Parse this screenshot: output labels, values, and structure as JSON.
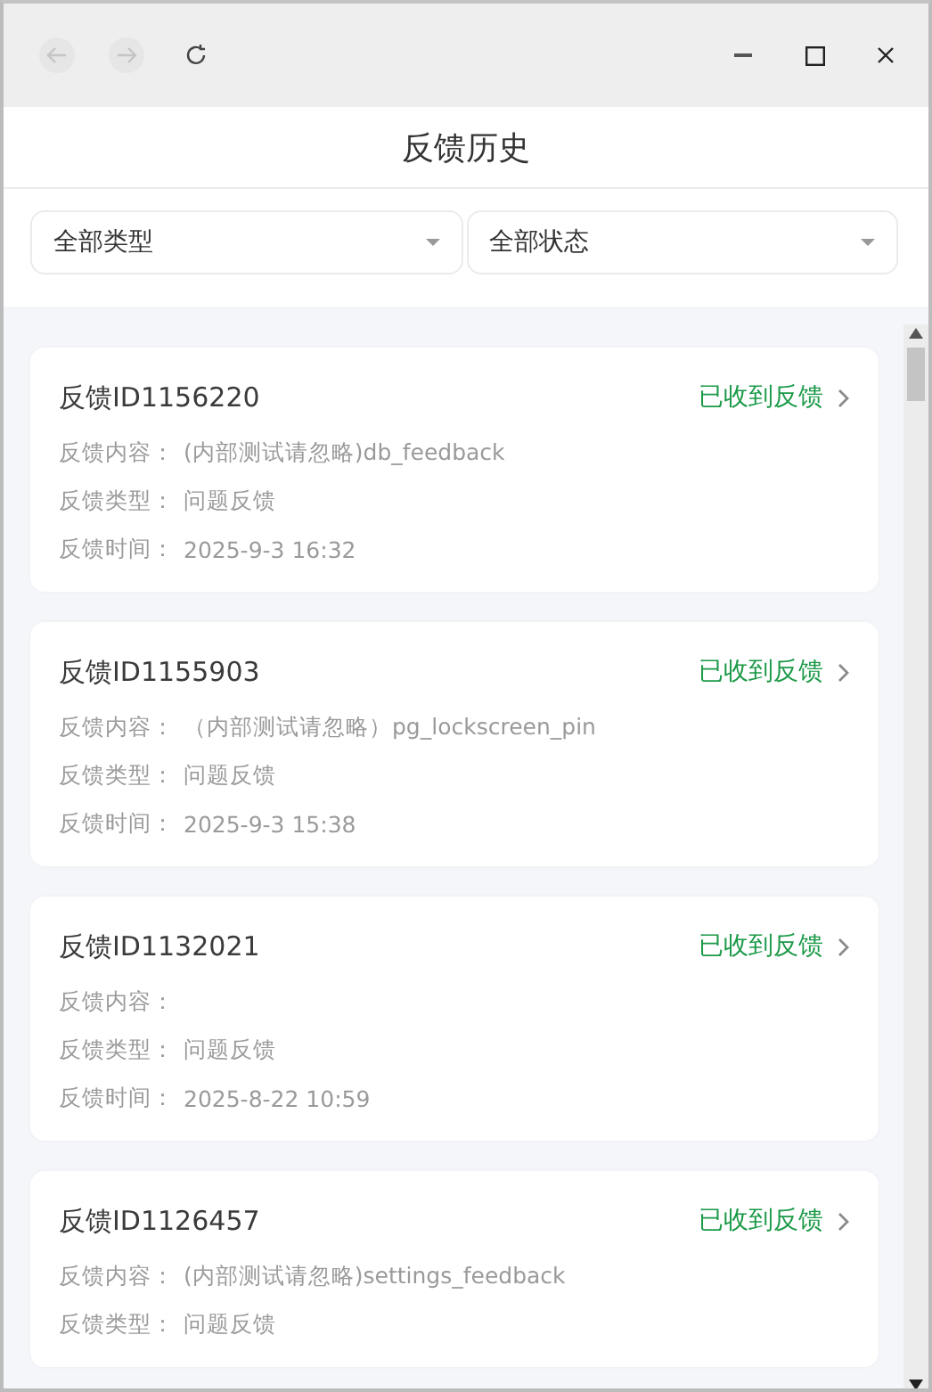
{
  "toolbar": {
    "nav": [
      {
        "kind": "back",
        "disabled": true
      },
      {
        "kind": "forward",
        "disabled": true
      },
      {
        "kind": "reload",
        "disabled": false
      }
    ]
  },
  "window": {
    "title": "反馈历史"
  },
  "filters": [
    {
      "value": "全部类型"
    },
    {
      "value": "全部状态"
    }
  ],
  "feedback_items": [
    {
      "title": "反馈ID1156220",
      "status": "已收到反馈",
      "fields": [
        {
          "label": "反馈内容：",
          "value": "(内部测试请忽略)db_feedback"
        },
        {
          "label": "反馈类型：",
          "value": "问题反馈"
        },
        {
          "label": "反馈时间：",
          "value": "2025-9-3 16:32"
        }
      ]
    },
    {
      "title": "反馈ID1155903",
      "status": "已收到反馈",
      "fields": [
        {
          "label": "反馈内容：",
          "value": "（内部测试请忽略）pg_lockscreen_pin"
        },
        {
          "label": "反馈类型：",
          "value": "问题反馈"
        },
        {
          "label": "反馈时间：",
          "value": "2025-9-3 15:38"
        }
      ]
    },
    {
      "title": "反馈ID1132021",
      "status": "已收到反馈",
      "fields": [
        {
          "label": "反馈内容："
        },
        {
          "label": "反馈类型：",
          "value": "问题反馈"
        },
        {
          "label": "反馈时间：",
          "value": "2025-8-22 10:59"
        }
      ]
    },
    {
      "title": "反馈ID1126457",
      "status": "已收到反馈",
      "fields": [
        {
          "label": "反馈内容：",
          "value": "(内部测试请忽略)settings_feedback"
        },
        {
          "label": "反馈类型：",
          "value": "问题反馈"
        }
      ]
    }
  ]
}
